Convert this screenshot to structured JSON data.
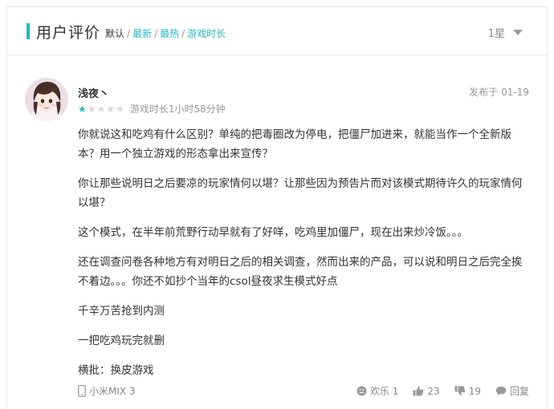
{
  "header": {
    "title": "用户评价",
    "sort_default": "默认",
    "sort_newest": "最新",
    "sort_hottest": "最热",
    "sort_playtime": "游戏时长",
    "separator": "/",
    "filter_label": "1星"
  },
  "review": {
    "username": "浅夜丶",
    "date_label": "发布于",
    "date": "01-19",
    "rating": 1,
    "rating_max": 5,
    "playtime": "游戏时长1小时58分钟",
    "paragraphs": [
      "你就说这和吃鸡有什么区别？单纯的把毒圈改为停电，把僵尸加进来，就能当作一个全新版本？用一个独立游戏的形态拿出来宣传？",
      "你让那些说明日之后要凉的玩家情何以堪？让那些因为预告片而对该模式期待许久的玩家情何以堪？",
      "这个模式，在半年前荒野行动早就有了好咩，吃鸡里加僵尸，现在出来炒冷饭。。。",
      "还在调查问卷各种地方有对明日之后的相关调查，然而出来的产品，可以说和明日之后完全挨不着边。。。你还不如抄个当年的csol昼夜求生模式好点",
      "千辛万苦抢到内测",
      "一把吃鸡玩完就删",
      "横批：换皮游戏"
    ],
    "device": "小米MIX 3",
    "happy_label": "欢乐",
    "happy_count": "1",
    "like_count": "23",
    "dislike_count": "19",
    "reply_label": "回复"
  },
  "colors": {
    "accent": "#2bb5c4",
    "star_off": "#d8d8d8",
    "muted": "#999999"
  }
}
